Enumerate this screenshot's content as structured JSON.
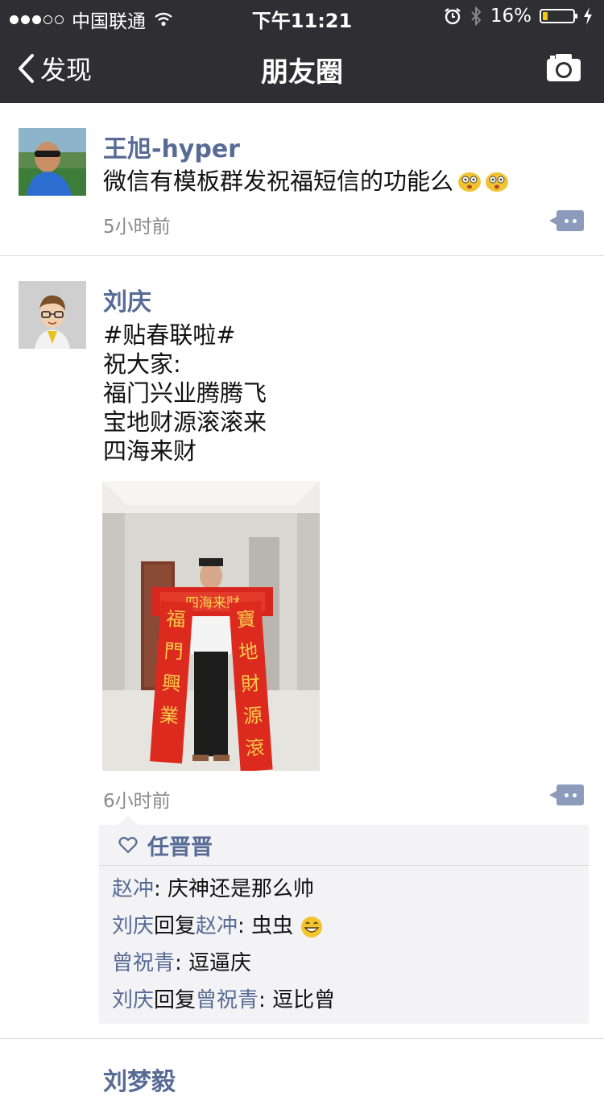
{
  "status_bar": {
    "carrier": "中国联通",
    "time": "下午11:21",
    "battery": "16%",
    "battery_level": 0.16,
    "signal_bars": 3
  },
  "nav": {
    "back_label": "发现",
    "title": "朋友圈"
  },
  "posts": [
    {
      "author": "王旭-hyper",
      "text": "微信有模板群发祝福短信的功能么",
      "time": "5小时前"
    },
    {
      "author": "刘庆",
      "text": "#贴春联啦#\n祝大家:\n福门兴业腾腾飞\n宝地财源滚滚来\n四海来财",
      "time": "6小时前",
      "photo_couplets": {
        "top": "四海来财",
        "left": "福門興業",
        "right": "寶地財源滾"
      },
      "likes": [
        "任晋晋"
      ],
      "comments": [
        {
          "from": "赵冲",
          "to": "",
          "reply_word": "",
          "sep": ": ",
          "text": "庆神还是那么帅"
        },
        {
          "from": "刘庆",
          "to": "赵冲",
          "reply_word": "回复",
          "sep": ": ",
          "text": "虫虫"
        },
        {
          "from": "曾祝青",
          "to": "",
          "reply_word": "",
          "sep": ": ",
          "text": "逗逼庆"
        },
        {
          "from": "刘庆",
          "to": "曾祝青",
          "reply_word": "回复",
          "sep": ": ",
          "text": "逗比曾"
        }
      ]
    },
    {
      "author": "刘梦毅"
    }
  ],
  "colors": {
    "topbar": "#2f2f33",
    "link": "#576b95",
    "comment_box": "#f3f3f5",
    "battery_fill": "#f5c518"
  },
  "icons": [
    "wifi-icon",
    "alarm-icon",
    "bluetooth-icon",
    "battery-icon",
    "charging-icon",
    "back-chevron-icon",
    "camera-icon",
    "comment-dots-icon",
    "heart-icon",
    "dizzy-face-emoji",
    "grin-emoji"
  ]
}
